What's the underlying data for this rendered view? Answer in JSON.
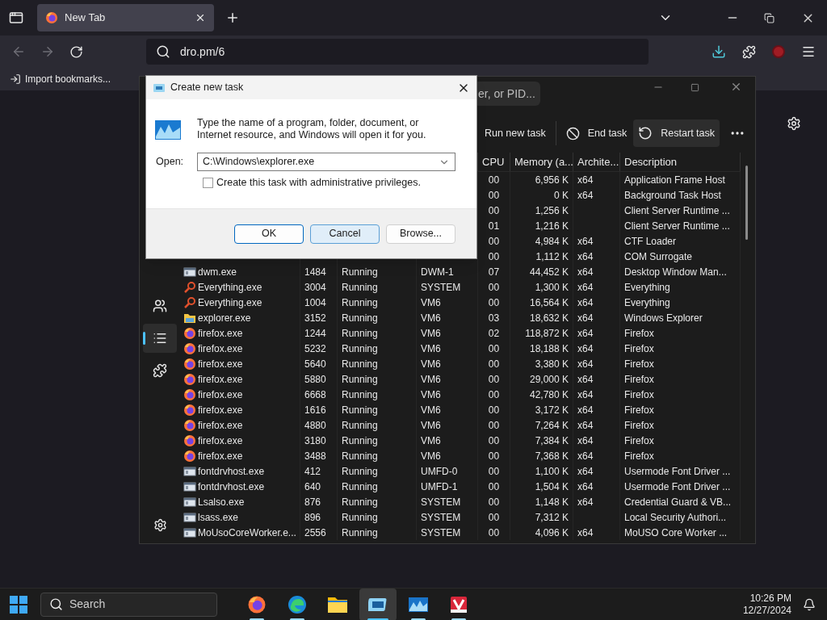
{
  "browser": {
    "tab": {
      "title": "New Tab"
    },
    "address": "dro.pm/6",
    "bookmarks": [
      "Import bookmarks..."
    ]
  },
  "task_manager": {
    "search_placeholder": "er, or PID...",
    "toolbar": [
      {
        "label": "Run new task",
        "kind": "run",
        "highlighted": false
      },
      {
        "label": "End task",
        "kind": "end",
        "highlighted": false
      },
      {
        "label": "Restart task",
        "kind": "restart",
        "highlighted": true
      }
    ],
    "sidebar": [
      {
        "kind": "users",
        "selected": false
      },
      {
        "kind": "details",
        "selected": true
      },
      {
        "kind": "services",
        "selected": false
      }
    ],
    "columns": [
      "CPU",
      "Memory (a...",
      "Archite...",
      "Description"
    ],
    "rows": [
      {
        "cpu": "00",
        "memory": "6,956 K",
        "arch": "x64",
        "description": "Application Frame Host"
      },
      {
        "cpu": "00",
        "memory": "0 K",
        "arch": "x64",
        "description": "Background Task Host"
      },
      {
        "cpu": "00",
        "memory": "1,256 K",
        "description": "Client Server Runtime ..."
      },
      {
        "cpu": "01",
        "memory": "1,216 K",
        "description": "Client Server Runtime ..."
      },
      {
        "cpu": "00",
        "memory": "4,984 K",
        "arch": "x64",
        "description": "CTF Loader"
      },
      {
        "cpu": "00",
        "memory": "1,112 K",
        "arch": "x64",
        "description": "COM Surrogate"
      },
      {
        "kind": "window",
        "name": "dwm.exe",
        "pid": "1484",
        "status": "Running",
        "user": "DWM-1",
        "cpu": "07",
        "memory": "44,452 K",
        "arch": "x64",
        "description": "Desktop Window Man..."
      },
      {
        "kind": "magnifier",
        "name": "Everything.exe",
        "pid": "3004",
        "status": "Running",
        "user": "SYSTEM",
        "cpu": "00",
        "memory": "1,300 K",
        "arch": "x64",
        "description": "Everything"
      },
      {
        "kind": "magnifier",
        "name": "Everything.exe",
        "pid": "1004",
        "status": "Running",
        "user": "VM6",
        "cpu": "00",
        "memory": "16,564 K",
        "arch": "x64",
        "description": "Everything"
      },
      {
        "kind": "folder",
        "name": "explorer.exe",
        "pid": "3152",
        "status": "Running",
        "user": "VM6",
        "cpu": "03",
        "memory": "18,632 K",
        "arch": "x64",
        "description": "Windows Explorer"
      },
      {
        "kind": "firefox",
        "name": "firefox.exe",
        "pid": "1244",
        "status": "Running",
        "user": "VM6",
        "cpu": "02",
        "memory": "118,872 K",
        "arch": "x64",
        "description": "Firefox"
      },
      {
        "kind": "firefox",
        "name": "firefox.exe",
        "pid": "5232",
        "status": "Running",
        "user": "VM6",
        "cpu": "00",
        "memory": "18,188 K",
        "arch": "x64",
        "description": "Firefox"
      },
      {
        "kind": "firefox",
        "name": "firefox.exe",
        "pid": "5640",
        "status": "Running",
        "user": "VM6",
        "cpu": "00",
        "memory": "3,380 K",
        "arch": "x64",
        "description": "Firefox"
      },
      {
        "kind": "firefox",
        "name": "firefox.exe",
        "pid": "5880",
        "status": "Running",
        "user": "VM6",
        "cpu": "00",
        "memory": "29,000 K",
        "arch": "x64",
        "description": "Firefox"
      },
      {
        "kind": "firefox",
        "name": "firefox.exe",
        "pid": "6668",
        "status": "Running",
        "user": "VM6",
        "cpu": "00",
        "memory": "42,780 K",
        "arch": "x64",
        "description": "Firefox"
      },
      {
        "kind": "firefox",
        "name": "firefox.exe",
        "pid": "1616",
        "status": "Running",
        "user": "VM6",
        "cpu": "00",
        "memory": "3,172 K",
        "arch": "x64",
        "description": "Firefox"
      },
      {
        "kind": "firefox",
        "name": "firefox.exe",
        "pid": "4880",
        "status": "Running",
        "user": "VM6",
        "cpu": "00",
        "memory": "7,264 K",
        "arch": "x64",
        "description": "Firefox"
      },
      {
        "kind": "firefox",
        "name": "firefox.exe",
        "pid": "3180",
        "status": "Running",
        "user": "VM6",
        "cpu": "00",
        "memory": "7,384 K",
        "arch": "x64",
        "description": "Firefox"
      },
      {
        "kind": "firefox",
        "name": "firefox.exe",
        "pid": "3488",
        "status": "Running",
        "user": "VM6",
        "cpu": "00",
        "memory": "7,368 K",
        "arch": "x64",
        "description": "Firefox"
      },
      {
        "kind": "window",
        "name": "fontdrvhost.exe",
        "pid": "412",
        "status": "Running",
        "user": "UMFD-0",
        "cpu": "00",
        "memory": "1,100 K",
        "arch": "x64",
        "description": "Usermode Font Driver ..."
      },
      {
        "kind": "window",
        "name": "fontdrvhost.exe",
        "pid": "640",
        "status": "Running",
        "user": "UMFD-1",
        "cpu": "00",
        "memory": "1,504 K",
        "arch": "x64",
        "description": "Usermode Font Driver ..."
      },
      {
        "kind": "window",
        "name": "Lsalso.exe",
        "pid": "876",
        "status": "Running",
        "user": "SYSTEM",
        "cpu": "00",
        "memory": "1,148 K",
        "arch": "x64",
        "description": "Credential Guard & VB..."
      },
      {
        "kind": "window",
        "name": "lsass.exe",
        "pid": "896",
        "status": "Running",
        "user": "SYSTEM",
        "cpu": "00",
        "memory": "7,312 K",
        "description": "Local Security Authori..."
      },
      {
        "kind": "window",
        "name": "MoUsoCoreWorker.e...",
        "pid": "2556",
        "status": "Running",
        "user": "SYSTEM",
        "cpu": "00",
        "memory": "4,096 K",
        "arch": "x64",
        "description": "MoUSO Core Worker ..."
      }
    ]
  },
  "dialog": {
    "title": "Create new task",
    "message": "Type the name of a program, folder, document, or Internet resource, and Windows will open it for you.",
    "open_label": "Open:",
    "open_value": "C:\\Windows\\explorer.exe",
    "admin_checkbox": {
      "label": "Create this task with administrative privileges.",
      "checked": false
    },
    "buttons": [
      {
        "label": "OK",
        "kind": "default"
      },
      {
        "label": "Cancel",
        "kind": "hover"
      },
      {
        "label": "Browse...",
        "kind": "normal"
      }
    ]
  },
  "taskbar": {
    "search_placeholder": "Search",
    "apps": [
      {
        "kind": "firefox",
        "running": true,
        "selected": false
      },
      {
        "kind": "edge",
        "running": true,
        "selected": false
      },
      {
        "kind": "explorer",
        "running": false,
        "selected": false
      },
      {
        "kind": "taskmanager",
        "running": true,
        "selected": true
      },
      {
        "kind": "photos",
        "running": true,
        "selected": false
      },
      {
        "kind": "viewer",
        "running": true,
        "selected": false
      }
    ],
    "time": "10:26 PM",
    "date": "12/27/2024"
  }
}
